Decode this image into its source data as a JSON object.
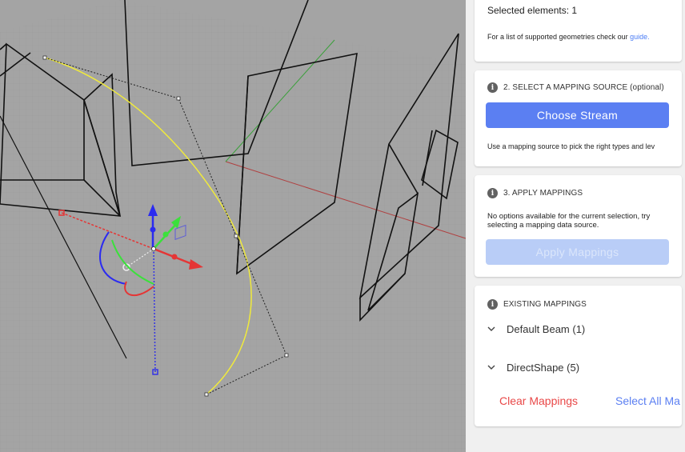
{
  "panel": {
    "selection": {
      "count_label": "Selected elements: 1",
      "help_text": "For a list of supported geometries check our",
      "help_link": "guide."
    },
    "mapping_source": {
      "heading": "2. SELECT A MAPPING SOURCE (optional)",
      "button_label": "Choose Stream",
      "description": "Use a mapping source to pick the right types and lev"
    },
    "apply_mappings": {
      "heading": "3. APPLY MAPPINGS",
      "message_line1": "No options available for the current selection, try",
      "message_line2": "selecting a mapping data source.",
      "button_label": "Apply Mappings"
    },
    "existing_mappings": {
      "heading": "EXISTING MAPPINGS",
      "items": [
        {
          "label": "Default Beam (1)"
        },
        {
          "label": "DirectShape (5)"
        }
      ],
      "clear_label": "Clear Mappings",
      "select_all_label": "Select All Ma"
    }
  },
  "icons": {
    "info": "info-icon",
    "expand": "chevron-down-icon",
    "gizmo": "transform-gizmo-icon"
  },
  "colors": {
    "primary": "#5b7ff2",
    "primary_disabled": "#b9cdf7",
    "danger": "#e94848",
    "viewport_bg": "#a4a4a4",
    "curve": "#f0ea3c"
  }
}
